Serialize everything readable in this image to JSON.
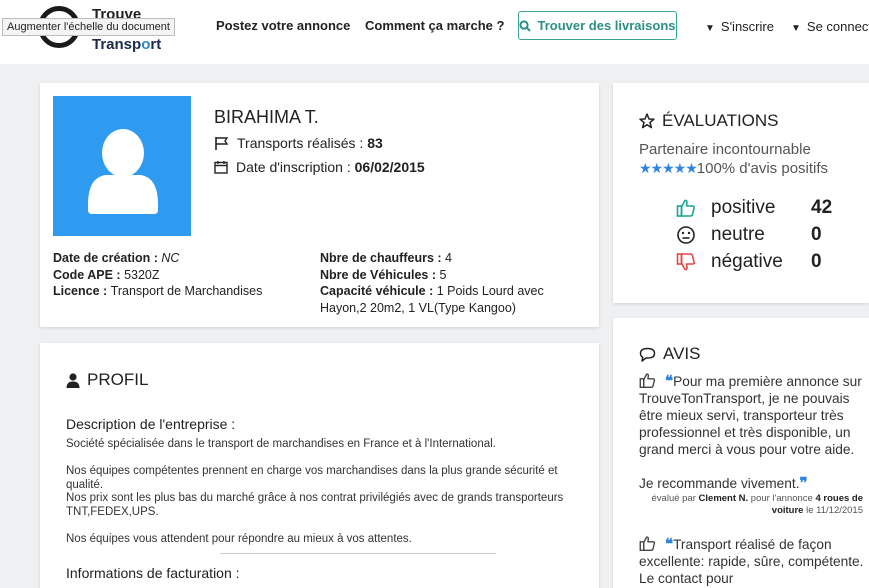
{
  "tooltip": "Augmenter l'échelle du document",
  "logo": {
    "line1": "Trouve",
    "line2_a": "Transp",
    "line2_b": "o",
    "line2_c": "rt"
  },
  "nav": {
    "post": "Postez votre annonce",
    "how": "Comment ça marche ?",
    "find": "Trouver des livraisons",
    "signup": "S'inscrire",
    "login": "Se connect"
  },
  "user": {
    "name": "BIRAHIMA T.",
    "transports_label": "Transports réalisés : ",
    "transports_value": "83",
    "date_label": "Date d'inscription : ",
    "date_value": "06/02/2015",
    "creation_label": "Date de création : ",
    "creation_value": "NC",
    "ape_label": "Code APE : ",
    "ape_value": "5320Z",
    "licence_label": "Licence : ",
    "licence_value": "Transport de Marchandises",
    "chauffeurs_label": "Nbre de chauffeurs : ",
    "chauffeurs_value": "4",
    "vehicules_label": "Nbre de Véhicules : ",
    "vehicules_value": "5",
    "capacite_label": "Capacité véhicule : ",
    "capacite_value_1": "1 Poids Lourd avec",
    "capacite_value_2": "Hayon,2 20m2, 1 VL(Type Kangoo)"
  },
  "profil": {
    "title": "PROFIL",
    "desc_title": "Description de l'entreprise :",
    "p1": "Société spécialisée dans le transport de marchandises en France et à l'International.",
    "p2": "Nos équipes compétentes prennent en charge vos marchandises dans la plus grande sécurité et qualité.",
    "p3": "Nos prix sont les plus bas du marché grâce à nos contrat privilégiés avec de grands transporteurs TNT,FEDEX,UPS.",
    "p4": "Nos équipes vous attendent pour répondre au mieux à vos attentes.",
    "factu": "Informations de facturation :"
  },
  "evaluations": {
    "title": "ÉVALUATIONS",
    "subtitle": "Partenaire incontournable",
    "stars": "★★★★★",
    "rating_fraction": 1.0,
    "positive_pct": "100% d'avis positifs",
    "rows": [
      {
        "label": "positive",
        "value": "42",
        "color": "#1aa68f"
      },
      {
        "label": "neutre",
        "value": "0",
        "color": "#222222"
      },
      {
        "label": "négative",
        "value": "0",
        "color": "#e04848"
      }
    ]
  },
  "avis": {
    "title": "AVIS",
    "items": [
      {
        "text": "Pour ma première annonce sur TrouveTonTransport, je ne pouvais être mieux servi, transporteur très professionnel et très disponible, un grand merci à vous pour votre aide.",
        "text2": "Je recommande vivement.",
        "meta_a": "évalué par ",
        "meta_author": "Clement N.",
        "meta_b": " pour l'annonce ",
        "meta_ad1": "4 roues de",
        "meta_ad2": "voiture",
        "meta_c": " le 11/12/2015"
      },
      {
        "text": "Transport réalisé de façon excellente: rapide, sûre, compétente. Le contact pour"
      }
    ]
  },
  "colors": {
    "accent": "#2e86de",
    "teal": "#3aa39a",
    "avatar_bg": "#2e9bf0"
  }
}
